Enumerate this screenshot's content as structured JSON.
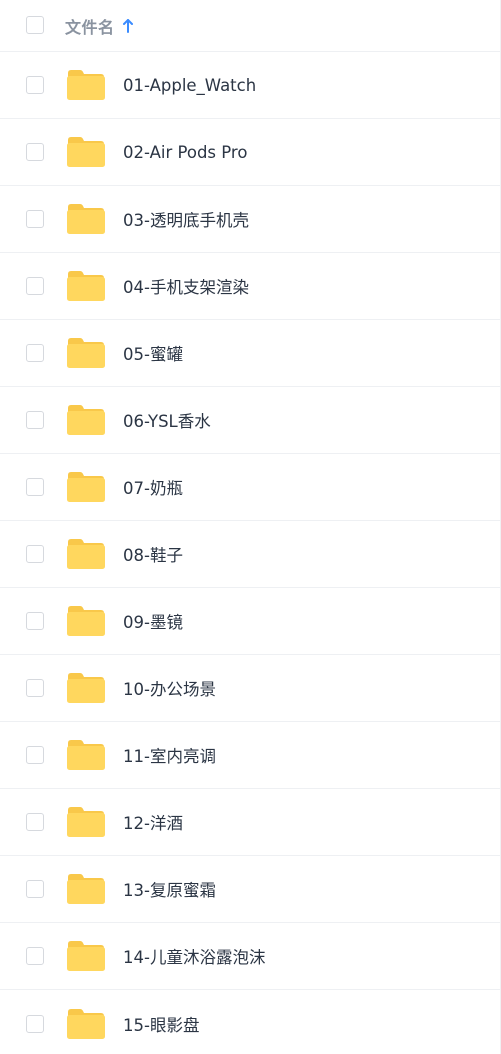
{
  "header": {
    "column_label": "文件名",
    "sort_icon": "arrow-up-icon"
  },
  "colors": {
    "folder_fill": "#FFD75E",
    "folder_tab": "#F9C84A",
    "sort_arrow": "#3b8cff",
    "text": "#2b3544",
    "header_text": "#8a93a0"
  },
  "files": [
    {
      "name": "01-Apple_Watch",
      "icon": "folder-icon"
    },
    {
      "name": "02-Air Pods Pro",
      "icon": "folder-icon"
    },
    {
      "name": "03-透明底手机壳",
      "icon": "folder-icon"
    },
    {
      "name": "04-手机支架渲染",
      "icon": "folder-icon"
    },
    {
      "name": "05-蜜罐",
      "icon": "folder-icon"
    },
    {
      "name": "06-YSL香水",
      "icon": "folder-icon"
    },
    {
      "name": "07-奶瓶",
      "icon": "folder-icon"
    },
    {
      "name": "08-鞋子",
      "icon": "folder-icon"
    },
    {
      "name": "09-墨镜",
      "icon": "folder-icon"
    },
    {
      "name": "10-办公场景",
      "icon": "folder-icon"
    },
    {
      "name": "11-室内亮调",
      "icon": "folder-icon"
    },
    {
      "name": "12-洋酒",
      "icon": "folder-icon"
    },
    {
      "name": "13-复原蜜霜",
      "icon": "folder-icon"
    },
    {
      "name": "14-儿童沐浴露泡沫",
      "icon": "folder-icon"
    },
    {
      "name": "15-眼影盘",
      "icon": "folder-icon"
    }
  ]
}
